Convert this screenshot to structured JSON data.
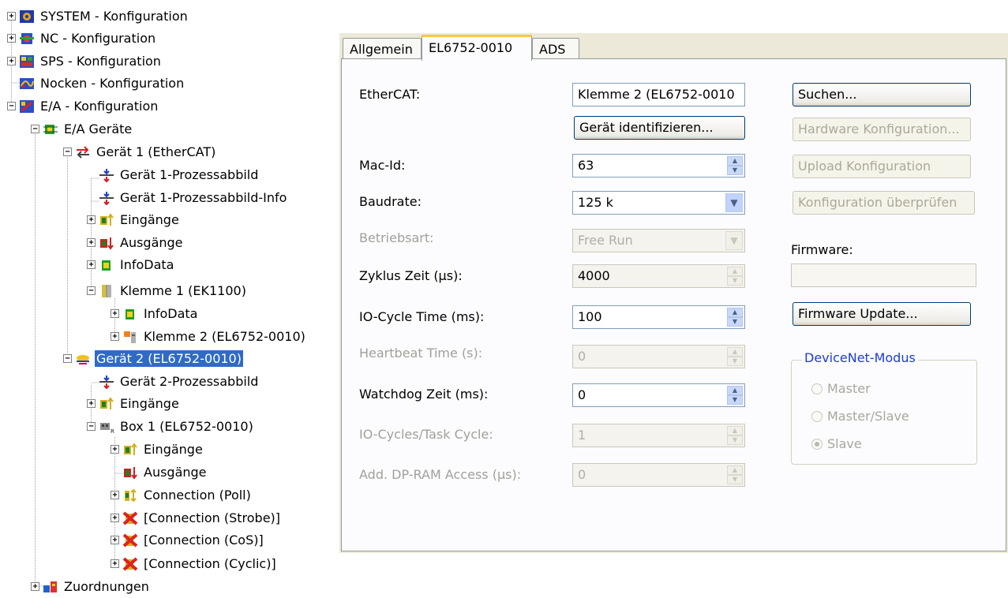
{
  "tree": {
    "nodes": [
      {
        "label": "SYSTEM - Konfiguration",
        "icon": "system-config-icon",
        "expander": "+"
      },
      {
        "label": "NC - Konfiguration",
        "icon": "nc-config-icon",
        "expander": "+"
      },
      {
        "label": "SPS - Konfiguration",
        "icon": "plc-config-icon",
        "expander": "+"
      },
      {
        "label": "Nocken - Konfiguration",
        "icon": "cam-config-icon",
        "expander": ""
      },
      {
        "label": "E/A - Konfiguration",
        "icon": "io-config-icon",
        "expander": "−"
      },
      {
        "label": "E/A Geräte",
        "icon": "io-devices-icon",
        "expander": "−"
      },
      {
        "label": "Gerät 1 (EtherCAT)",
        "icon": "ethercat-device-icon",
        "expander": "−"
      },
      {
        "label": "Gerät 1-Prozessabbild",
        "icon": "process-image-icon",
        "expander": ""
      },
      {
        "label": "Gerät 1-Prozessabbild-Info",
        "icon": "process-image-icon",
        "expander": ""
      },
      {
        "label": "Eingänge",
        "icon": "inputs-icon",
        "expander": "+"
      },
      {
        "label": "Ausgänge",
        "icon": "outputs-icon",
        "expander": "+"
      },
      {
        "label": "InfoData",
        "icon": "infodata-icon",
        "expander": "+"
      },
      {
        "label": "Klemme 1 (EK1100)",
        "icon": "coupler-terminal-icon",
        "expander": "−"
      },
      {
        "label": "InfoData",
        "icon": "infodata-icon",
        "expander": "+"
      },
      {
        "label": "Klemme 2 (EL6752-0010)",
        "icon": "terminal-icon",
        "expander": "+"
      },
      {
        "label": "Gerät 2 (EL6752-0010)",
        "icon": "devicenet-device-icon",
        "expander": "−"
      },
      {
        "label": "Gerät 2-Prozessabbild",
        "icon": "process-image-icon",
        "expander": ""
      },
      {
        "label": "Eingänge",
        "icon": "inputs-icon",
        "expander": "+"
      },
      {
        "label": "Box 1 (EL6752-0010)",
        "icon": "box-icon",
        "expander": "−"
      },
      {
        "label": "Eingänge",
        "icon": "inputs-icon",
        "expander": "+"
      },
      {
        "label": "Ausgänge",
        "icon": "outputs-icon",
        "expander": ""
      },
      {
        "label": "Connection (Poll)",
        "icon": "connection-poll-icon",
        "expander": "+"
      },
      {
        "label": "[Connection (Strobe)]",
        "icon": "connection-disabled-icon",
        "expander": "+"
      },
      {
        "label": "[Connection (CoS)]",
        "icon": "connection-disabled-icon",
        "expander": "+"
      },
      {
        "label": "[Connection (Cyclic)]",
        "icon": "connection-disabled-icon",
        "expander": "+"
      },
      {
        "label": "Zuordnungen",
        "icon": "mappings-icon",
        "expander": "+"
      }
    ],
    "selected_label": "Gerät 2 (EL6752-0010)"
  },
  "tabs": [
    {
      "label": "Allgemein"
    },
    {
      "label": "EL6752-0010"
    },
    {
      "label": "ADS"
    }
  ],
  "form": {
    "ethercat": {
      "label": "EtherCAT:",
      "value": "Klemme 2 (EL6752-0010"
    },
    "identify_button": "Gerät identifizieren...",
    "mac_id": {
      "label": "Mac-Id:",
      "value": "63"
    },
    "baudrate": {
      "label": "Baudrate:",
      "value": "125 k"
    },
    "betriebsart": {
      "label": "Betriebsart:",
      "value": "Free Run"
    },
    "zyklus_zeit": {
      "label": "Zyklus Zeit (µs):",
      "value": "4000"
    },
    "io_cycle_time": {
      "label": "IO-Cycle Time (ms):",
      "value": "100"
    },
    "heartbeat_time": {
      "label": "Heartbeat Time (s):",
      "value": "0"
    },
    "watchdog_zeit": {
      "label": "Watchdog Zeit (ms):",
      "value": "0"
    },
    "io_cycles_task": {
      "label": "IO-Cycles/Task Cycle:",
      "value": "1"
    },
    "dp_ram_access": {
      "label": "Add. DP-RAM Access (µs):",
      "value": "0"
    }
  },
  "side": {
    "suchen_button": "Suchen...",
    "hw_config_button": "Hardware Konfiguration...",
    "upload_config_button": "Upload Konfiguration",
    "check_config_button": "Konfiguration überprüfen",
    "firmware_label": "Firmware:",
    "firmware_value": "",
    "firmware_update_button": "Firmware Update...",
    "devicenet_group": {
      "title": "DeviceNet-Modus",
      "options": [
        "Master",
        "Master/Slave",
        "Slave"
      ],
      "selected": "Slave"
    }
  },
  "colors": {
    "selection": "#316ac5",
    "panel": "#ece9d8",
    "page": "#fcfcfe",
    "group_title": "#1e3cd2",
    "active_tab_accent": "#ffc83c"
  }
}
